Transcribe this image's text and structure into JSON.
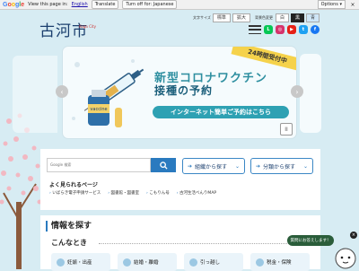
{
  "translate_bar": {
    "brand": "Google",
    "prompt": "View this page in:",
    "language": "English",
    "translate_label": "Translate",
    "turn_off_label": "Turn off for: Japanese",
    "options_label": "Options ▾",
    "close_label": "×"
  },
  "header": {
    "logo_text": "古河市",
    "logo_sub": "Koga City",
    "font_size_label": "文字サイズ",
    "font_size_options": [
      "標準",
      "拡大"
    ],
    "bg_color_label": "背景色変更",
    "bg_color_options": [
      "白",
      "黒",
      "青"
    ],
    "sns": [
      {
        "name": "line-icon",
        "glyph": "L",
        "color": "#06c755"
      },
      {
        "name": "instagram-icon",
        "glyph": "◎",
        "color": "#d6336c"
      },
      {
        "name": "youtube-icon",
        "glyph": "▶",
        "color": "#e62117"
      },
      {
        "name": "twitter-icon",
        "glyph": "t",
        "color": "#1da1f2"
      },
      {
        "name": "facebook-icon",
        "glyph": "f",
        "color": "#1877f2"
      }
    ]
  },
  "banner": {
    "ribbon": "24時間受付中",
    "title1": "新型コロナワクチン",
    "title2": "接種の予約",
    "cta": "インターネット簡単ご予約はこちら",
    "vial_label": "vaccine",
    "pause_label": "II",
    "prev_label": "‹",
    "next_label": "›"
  },
  "search": {
    "placeholder": "Google 検索",
    "find_by_org": "組織から探す",
    "find_by_category": "分類から探す",
    "frequent_title": "よく見られるページ",
    "frequent_items": [
      "いばらき電子申請サービス",
      "図書館・図書室",
      "こもりん号",
      "古河生活べんりMAP"
    ]
  },
  "info": {
    "title": "情報を探す",
    "subtitle": "こんなとき",
    "cards": [
      "妊娠・出産",
      "結婚・離婚",
      "引っ越し",
      "税金・保険"
    ]
  },
  "chat": {
    "label": "質問にお答えします！",
    "close": "×"
  },
  "colors": {
    "background": "#d7ecf3",
    "accent": "#2a7abf",
    "banner_teal": "#2ea1b3"
  }
}
